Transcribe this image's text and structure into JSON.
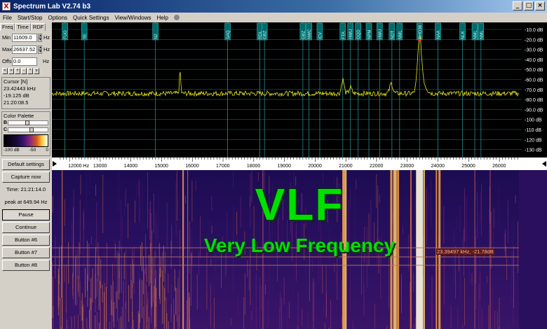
{
  "window": {
    "title": "Spectrum Lab V2.74 b3",
    "icon": "X",
    "buttons": [
      "_",
      "□",
      "×"
    ]
  },
  "menu": [
    "File",
    "Start/Stop",
    "Options",
    "Quick Settings",
    "View/Windows",
    "Help"
  ],
  "left": {
    "tabs": [
      "Freq",
      "Time",
      "RDF"
    ],
    "min_label": "Min",
    "min_value": "11609.0",
    "max_label": "Max",
    "max_value": "26637.52",
    "offs_label": "Offs",
    "offs_value": "0.0",
    "hz": "Hz",
    "arrows": [
      "<",
      ">",
      "+",
      "-",
      "^",
      "v"
    ],
    "cursor_title": "Cursor [N]",
    "cursor_freq": "23.42443 kHz",
    "cursor_db": "-19.125 dB",
    "cursor_time": "21:20:08.5",
    "palette_title": "Color Palette",
    "palette_b": "B",
    "palette_c": "C",
    "palette_scale": [
      "-100 dB",
      "-50",
      "0"
    ],
    "default_settings": "Default settings",
    "capture_now": "Capture now",
    "time_readout": "Time:  21:21:14.0",
    "peak_readout": "peak at 649.94 Hz",
    "pause": "Pause",
    "continue": "Continue",
    "button6": "Button #6",
    "button7": "Button #7",
    "button8": "Button #8"
  },
  "spectrum": {
    "db_labels": [
      "-10.0 dB",
      "-20.0 dB",
      "-30.0 dB",
      "-40.0 dB",
      "-50.0 dB",
      "-60.0 dB",
      "-70.0 dB",
      "-80.0 dB",
      "-90.0 dB",
      "-100 dB",
      "-110 dB",
      "-120 dB",
      "-130 dB"
    ],
    "markers": [
      {
        "f": 11850,
        "label": "FUO"
      },
      {
        "f": 12480,
        "label": "SE"
      },
      {
        "f": 14800,
        "label": "N2"
      },
      {
        "f": 17150,
        "label": "SAQ"
      },
      {
        "f": 18200,
        "label": "RDL"
      },
      {
        "f": 18350,
        "label": "GBZ"
      },
      {
        "f": 19600,
        "label": "GBZ"
      },
      {
        "f": 19800,
        "label": "NWC"
      },
      {
        "f": 20150,
        "label": "ICV"
      },
      {
        "f": 20900,
        "label": "FTA"
      },
      {
        "f": 21150,
        "label": "HWU"
      },
      {
        "f": 21400,
        "label": "GQD"
      },
      {
        "f": 21750,
        "label": "NPM"
      },
      {
        "f": 22100,
        "label": "HWU"
      },
      {
        "f": 22500,
        "label": "NDT"
      },
      {
        "f": 22750,
        "label": "NML"
      },
      {
        "f": 23400,
        "label": "DHO38"
      },
      {
        "f": 24000,
        "label": "NAA"
      },
      {
        "f": 24800,
        "label": "NLK"
      },
      {
        "f": 25200,
        "label": "NML"
      },
      {
        "f": 25400,
        "label": "NML"
      }
    ]
  },
  "axis": {
    "unit_label": "12000 Hz",
    "ticks": [
      13000,
      14000,
      15000,
      16000,
      17000,
      18000,
      19000,
      20000,
      21000,
      22000,
      23000,
      24000,
      25000,
      26000
    ]
  },
  "overlay": {
    "title": "VLF",
    "subtitle": "Very Low Frequency",
    "cursor_readout": "23.39497 kHz, -21.78dB"
  },
  "colors": {
    "trace": "#e6e620",
    "grid": "#2a8a8a",
    "marker_fill": "#006a6a",
    "overlay_text": "#00e000"
  }
}
